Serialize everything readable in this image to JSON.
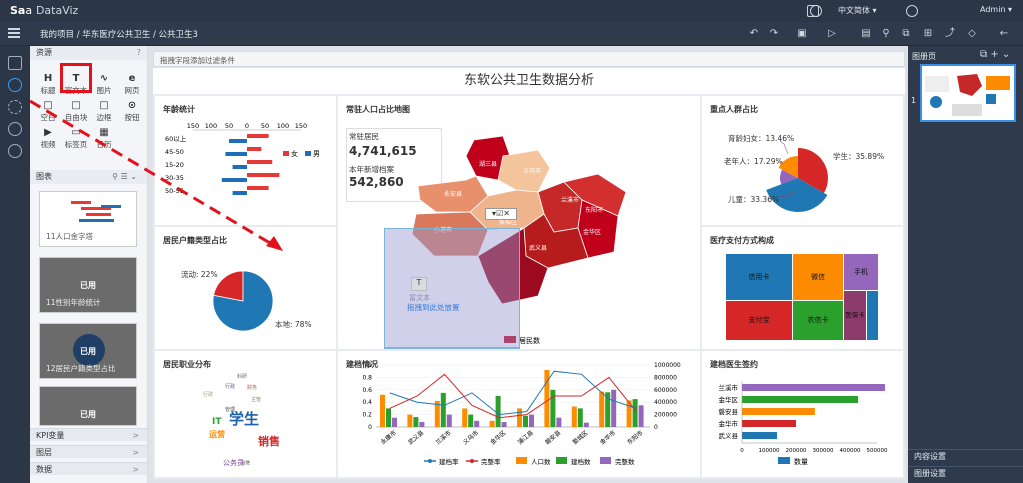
{
  "app": {
    "logo_main": "Sa",
    "logo_mid": "a",
    "logo_sub": "DataViz",
    "lang": "中文简体 ▾",
    "user": "Admin ▾"
  },
  "breadcrumb": "我的项目 / 华东医疗公共卫生 / 公共卫生3",
  "sidebar": {
    "resources_title": "资源",
    "items": [
      "标题",
      "富文本",
      "图片",
      "网页",
      "空白",
      "自由块",
      "边框",
      "按钮",
      "视频",
      "标签页",
      "日历"
    ],
    "item_icons": [
      "H",
      "T",
      "∿",
      "e",
      "□",
      "□",
      "□",
      "⊙",
      "▶",
      "▭",
      "▦"
    ],
    "charts_title": "图表",
    "thumbs": [
      {
        "caption": "11人口金字塔",
        "used": ""
      },
      {
        "caption": "11性别年龄统计",
        "used": "已用"
      },
      {
        "caption": "12居民户籍类型占比",
        "used": "已用"
      },
      {
        "caption": "",
        "used": "已用"
      }
    ],
    "bottom": [
      "KPI变量",
      "图层",
      "数据"
    ]
  },
  "canvas": {
    "filter_hint": "拖拽字段添加过滤条件",
    "dashboard_title": "东软公共卫生数据分析"
  },
  "panels": {
    "age": {
      "title": "年龄统计",
      "axis_ticks": [
        "150",
        "100",
        "50",
        "0",
        "50",
        "100",
        "150"
      ],
      "groups": [
        "60以上",
        "45-50",
        "15-20",
        "30-35",
        "50-55"
      ],
      "legend": [
        "女",
        "男"
      ]
    },
    "map": {
      "title": "常驻人口占比地图",
      "kpi1_label": "常驻居民",
      "kpi1_value": "4,741,615",
      "kpi2_label": "本年新增档案",
      "kpi2_value": "542,860",
      "regions": [
        "湖三县",
        "义乌市",
        "兰溪市",
        "东阳市",
        "金华区",
        "永安县",
        "婺城区",
        "小港市",
        "武义县"
      ],
      "legend": "居民数",
      "drop_text": "富文本",
      "drop_hint": "拖拽到此处放置"
    },
    "focus": {
      "title": "重点人群占比",
      "labels": [
        "育龄妇女：13.46%",
        "老年人：17.29%",
        "儿童：33.36%",
        "学生：35.89%"
      ]
    },
    "household": {
      "title": "居民户籍类型占比",
      "labels": [
        "流动: 22%",
        "本地: 78%"
      ]
    },
    "payment": {
      "title": "医疗支付方式构成",
      "cells": [
        "信用卡",
        "微信",
        "手机",
        "支付宝",
        "农信卡",
        "医保卡"
      ]
    },
    "occupation": {
      "title": "居民职业分布",
      "words": [
        "学生",
        "销售",
        "运营",
        "IT",
        "公务员",
        "科研",
        "行政",
        "财务",
        "管理",
        "行政",
        "主管",
        "运维"
      ]
    },
    "records": {
      "title": "建档情况",
      "left_ticks": [
        "1",
        "0.8",
        "0.6",
        "0.4",
        "0.2",
        "0"
      ],
      "right_ticks": [
        "1000000",
        "800000",
        "600000",
        "400000",
        "200000",
        "0"
      ],
      "cities": [
        "永康市",
        "武义县",
        "兰溪市",
        "义乌市",
        "金华区",
        "浦江县",
        "磐安县",
        "婺城区",
        "金华市",
        "东阳市"
      ],
      "legend": [
        "建档率",
        "完整率",
        "人口数",
        "建档数",
        "完整数"
      ]
    },
    "signing": {
      "title": "建档医生签约",
      "rows": [
        "兰溪市",
        "金华区",
        "磐安县",
        "金华市",
        "武义县"
      ],
      "ticks": [
        "0",
        "100000",
        "200000",
        "300000",
        "400000",
        "500000"
      ],
      "legend": "数量"
    }
  },
  "right_panel": {
    "title": "图册页",
    "page_no": "1",
    "bottom": [
      "内容设置",
      "图册设置"
    ]
  },
  "chart_data": [
    {
      "type": "bar",
      "title": "年龄统计",
      "categories": [
        "60以上",
        "45-50",
        "15-20",
        "30-35",
        "50-55"
      ],
      "series": [
        {
          "name": "女",
          "values": [
            60,
            40,
            70,
            90,
            60
          ]
        },
        {
          "name": "男",
          "values": [
            -50,
            -60,
            -40,
            -70,
            -40
          ]
        }
      ],
      "xlim": [
        -150,
        150
      ]
    },
    {
      "type": "pie",
      "title": "重点人群占比",
      "categories": [
        "育龄妇女",
        "老年人",
        "儿童",
        "学生"
      ],
      "values": [
        13.46,
        17.29,
        33.36,
        35.89
      ]
    },
    {
      "type": "pie",
      "title": "居民户籍类型占比",
      "categories": [
        "流动",
        "本地"
      ],
      "values": [
        22,
        78
      ]
    },
    {
      "type": "bar",
      "title": "建档情况",
      "categories": [
        "永康市",
        "武义县",
        "兰溪市",
        "义乌市",
        "金华区",
        "浦江县",
        "磐安县",
        "婺城区",
        "金华市",
        "东阳市"
      ],
      "series": [
        {
          "name": "人口数",
          "values": [
            520000,
            200000,
            420000,
            300000,
            100000,
            300000,
            920000,
            330000,
            570000,
            430000
          ]
        },
        {
          "name": "建档数",
          "values": [
            300000,
            160000,
            550000,
            200000,
            500000,
            180000,
            600000,
            300000,
            560000,
            450000
          ]
        },
        {
          "name": "完整数",
          "values": [
            150000,
            80000,
            200000,
            100000,
            80000,
            200000,
            150000,
            70000,
            600000,
            350000
          ]
        },
        {
          "name": "建档率",
          "values": [
            0.55,
            0.4,
            0.35,
            0.55,
            0.2,
            0.25,
            0.9,
            0.85,
            0.45,
            0.3
          ]
        },
        {
          "name": "完整率",
          "values": [
            0.3,
            0.5,
            0.85,
            0.35,
            0.15,
            0.2,
            0.5,
            0.5,
            0.8,
            0.25
          ]
        }
      ],
      "ylim": [
        0,
        1
      ],
      "y2lim": [
        0,
        1000000
      ]
    },
    {
      "type": "bar",
      "title": "建档医生签约",
      "categories": [
        "兰溪市",
        "金华区",
        "磐安县",
        "金华市",
        "武义县"
      ],
      "values": [
        560000,
        430000,
        270000,
        200000,
        130000
      ],
      "xlim": [
        0,
        500000
      ]
    }
  ]
}
